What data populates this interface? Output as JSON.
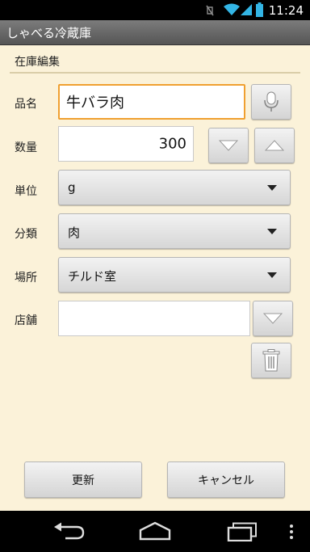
{
  "status_bar": {
    "time": "11:24"
  },
  "app": {
    "title": "しゃべる冷蔵庫"
  },
  "screen": {
    "section_title": "在庫編集"
  },
  "form": {
    "name": {
      "label": "品名",
      "value": "牛バラ肉"
    },
    "quantity": {
      "label": "数量",
      "value": "300"
    },
    "unit": {
      "label": "単位",
      "value": "g"
    },
    "category": {
      "label": "分類",
      "value": "肉"
    },
    "location": {
      "label": "場所",
      "value": "チルド室"
    },
    "store": {
      "label": "店舗",
      "value": ""
    }
  },
  "actions": {
    "update_label": "更新",
    "cancel_label": "キャンセル"
  }
}
